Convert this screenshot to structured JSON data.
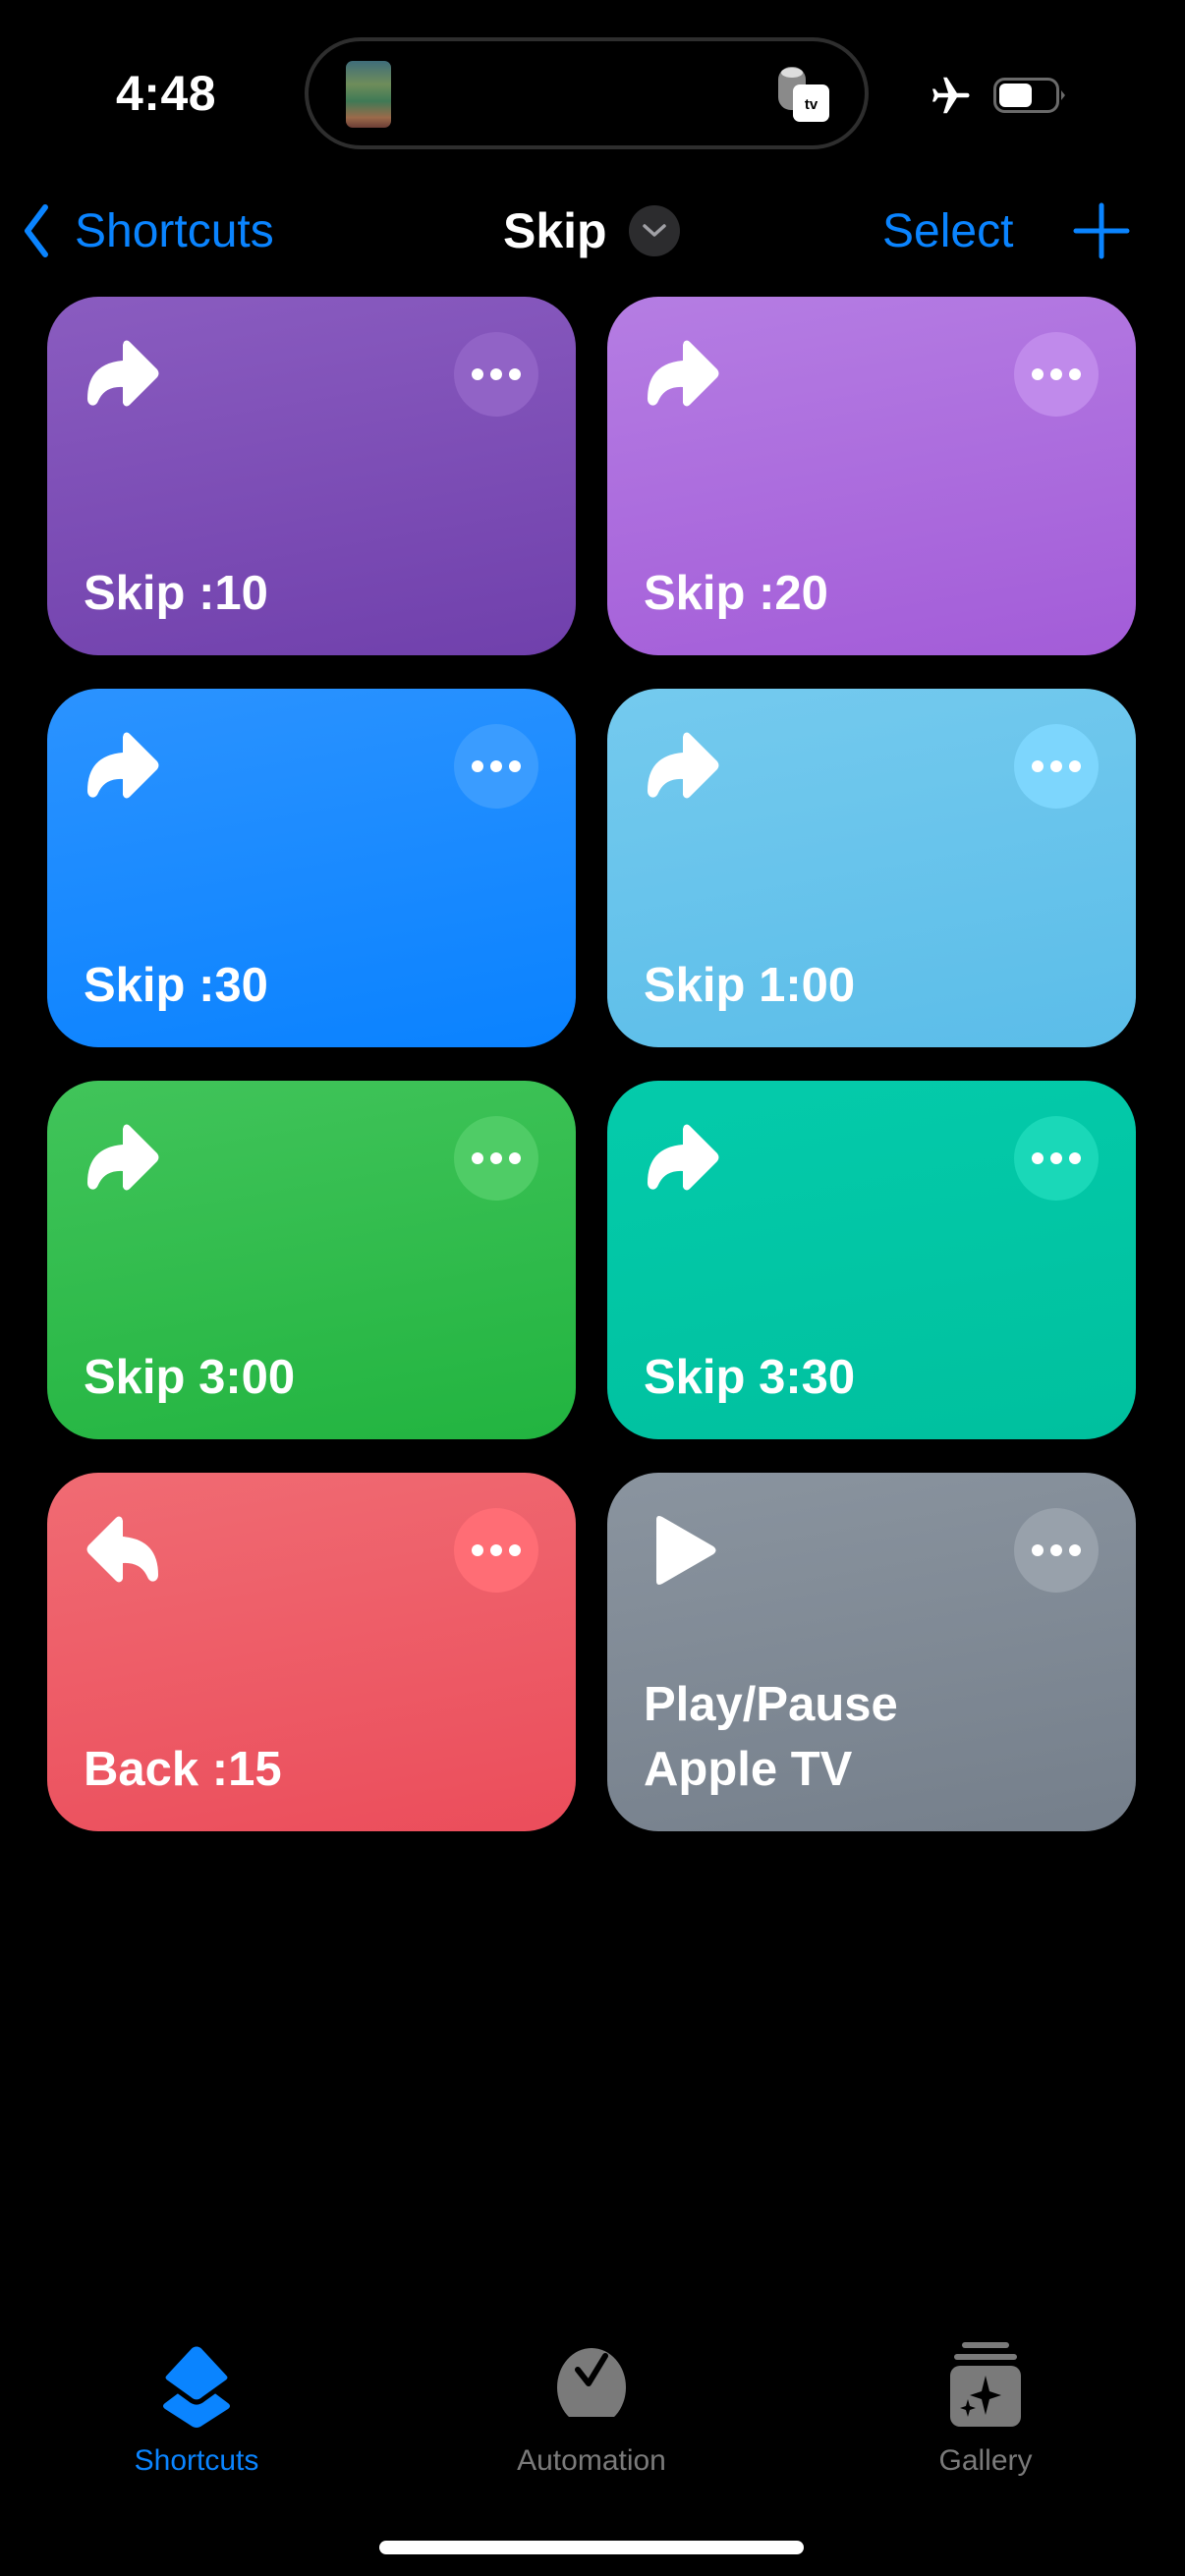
{
  "status_bar": {
    "time": "4:48",
    "battery_level": 0.6,
    "airplane_mode": true,
    "live_activity": {
      "artwork": "tv-show-poster-thumbnail",
      "device_icon": "homepod-appletv-icon",
      "device_badge": "tv"
    }
  },
  "nav": {
    "back_label": "Shortcuts",
    "title": "Skip",
    "select_label": "Select",
    "add_icon": "plus-icon"
  },
  "shortcuts": [
    {
      "label": "Skip :10",
      "icon": "arrow-turn-up-right-icon",
      "color_top": "#8a5cc0",
      "color_bottom": "#7040ac",
      "more_bg": "#9163c6"
    },
    {
      "label": "Skip :20",
      "icon": "arrow-turn-up-right-icon",
      "color_top": "#b57de3",
      "color_bottom": "#a35cd8",
      "more_bg": "#c08aeb"
    },
    {
      "label": "Skip :30",
      "icon": "arrow-turn-up-right-icon",
      "color_top": "#2b93ff",
      "color_bottom": "#0a82ff",
      "more_bg": "#3a9cff"
    },
    {
      "label": "Skip 1:00",
      "icon": "arrow-turn-up-right-icon",
      "color_top": "#74caee",
      "color_bottom": "#5bbde9",
      "more_bg": "#7dd6fd"
    },
    {
      "label": "Skip 3:00",
      "icon": "arrow-turn-up-right-icon",
      "color_top": "#41c45a",
      "color_bottom": "#22b440",
      "more_bg": "#4fcc66"
    },
    {
      "label": "Skip 3:30",
      "icon": "arrow-turn-up-right-icon",
      "color_top": "#04cbab",
      "color_bottom": "#00c09e",
      "more_bg": "#1ad8b8"
    },
    {
      "label": "Back :15",
      "icon": "arrow-turn-up-left-icon",
      "color_top": "#f06b73",
      "color_bottom": "#eb4d5b",
      "more_bg": "#ff6d75"
    },
    {
      "label": "Play/Pause\nApple TV",
      "icon": "play-icon",
      "color_top": "#8a949f",
      "color_bottom": "#757f8b",
      "more_bg": "#98a1ab"
    }
  ],
  "tabs": [
    {
      "label": "Shortcuts",
      "icon": "stacked-squares-icon",
      "active": true
    },
    {
      "label": "Automation",
      "icon": "clock-checkmark-icon",
      "active": false
    },
    {
      "label": "Gallery",
      "icon": "sparkles-stack-icon",
      "active": false
    }
  ],
  "colors": {
    "accent": "#0a84ff",
    "inactive_tab": "#7a7a7a",
    "background": "#000000"
  }
}
